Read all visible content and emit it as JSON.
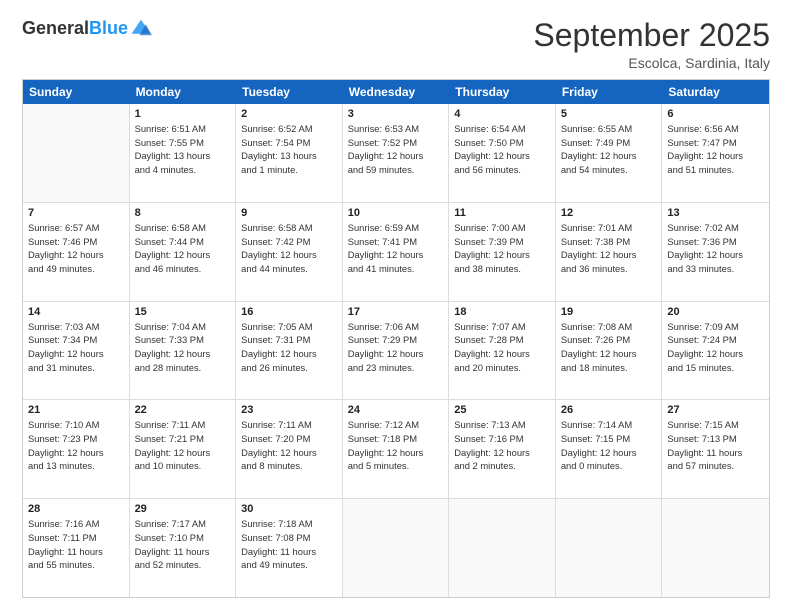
{
  "logo": {
    "general": "General",
    "blue": "Blue"
  },
  "title": "September 2025",
  "subtitle": "Escolca, Sardinia, Italy",
  "days": [
    "Sunday",
    "Monday",
    "Tuesday",
    "Wednesday",
    "Thursday",
    "Friday",
    "Saturday"
  ],
  "weeks": [
    [
      {
        "day": "",
        "lines": []
      },
      {
        "day": "1",
        "lines": [
          "Sunrise: 6:51 AM",
          "Sunset: 7:55 PM",
          "Daylight: 13 hours",
          "and 4 minutes."
        ]
      },
      {
        "day": "2",
        "lines": [
          "Sunrise: 6:52 AM",
          "Sunset: 7:54 PM",
          "Daylight: 13 hours",
          "and 1 minute."
        ]
      },
      {
        "day": "3",
        "lines": [
          "Sunrise: 6:53 AM",
          "Sunset: 7:52 PM",
          "Daylight: 12 hours",
          "and 59 minutes."
        ]
      },
      {
        "day": "4",
        "lines": [
          "Sunrise: 6:54 AM",
          "Sunset: 7:50 PM",
          "Daylight: 12 hours",
          "and 56 minutes."
        ]
      },
      {
        "day": "5",
        "lines": [
          "Sunrise: 6:55 AM",
          "Sunset: 7:49 PM",
          "Daylight: 12 hours",
          "and 54 minutes."
        ]
      },
      {
        "day": "6",
        "lines": [
          "Sunrise: 6:56 AM",
          "Sunset: 7:47 PM",
          "Daylight: 12 hours",
          "and 51 minutes."
        ]
      }
    ],
    [
      {
        "day": "7",
        "lines": [
          "Sunrise: 6:57 AM",
          "Sunset: 7:46 PM",
          "Daylight: 12 hours",
          "and 49 minutes."
        ]
      },
      {
        "day": "8",
        "lines": [
          "Sunrise: 6:58 AM",
          "Sunset: 7:44 PM",
          "Daylight: 12 hours",
          "and 46 minutes."
        ]
      },
      {
        "day": "9",
        "lines": [
          "Sunrise: 6:58 AM",
          "Sunset: 7:42 PM",
          "Daylight: 12 hours",
          "and 44 minutes."
        ]
      },
      {
        "day": "10",
        "lines": [
          "Sunrise: 6:59 AM",
          "Sunset: 7:41 PM",
          "Daylight: 12 hours",
          "and 41 minutes."
        ]
      },
      {
        "day": "11",
        "lines": [
          "Sunrise: 7:00 AM",
          "Sunset: 7:39 PM",
          "Daylight: 12 hours",
          "and 38 minutes."
        ]
      },
      {
        "day": "12",
        "lines": [
          "Sunrise: 7:01 AM",
          "Sunset: 7:38 PM",
          "Daylight: 12 hours",
          "and 36 minutes."
        ]
      },
      {
        "day": "13",
        "lines": [
          "Sunrise: 7:02 AM",
          "Sunset: 7:36 PM",
          "Daylight: 12 hours",
          "and 33 minutes."
        ]
      }
    ],
    [
      {
        "day": "14",
        "lines": [
          "Sunrise: 7:03 AM",
          "Sunset: 7:34 PM",
          "Daylight: 12 hours",
          "and 31 minutes."
        ]
      },
      {
        "day": "15",
        "lines": [
          "Sunrise: 7:04 AM",
          "Sunset: 7:33 PM",
          "Daylight: 12 hours",
          "and 28 minutes."
        ]
      },
      {
        "day": "16",
        "lines": [
          "Sunrise: 7:05 AM",
          "Sunset: 7:31 PM",
          "Daylight: 12 hours",
          "and 26 minutes."
        ]
      },
      {
        "day": "17",
        "lines": [
          "Sunrise: 7:06 AM",
          "Sunset: 7:29 PM",
          "Daylight: 12 hours",
          "and 23 minutes."
        ]
      },
      {
        "day": "18",
        "lines": [
          "Sunrise: 7:07 AM",
          "Sunset: 7:28 PM",
          "Daylight: 12 hours",
          "and 20 minutes."
        ]
      },
      {
        "day": "19",
        "lines": [
          "Sunrise: 7:08 AM",
          "Sunset: 7:26 PM",
          "Daylight: 12 hours",
          "and 18 minutes."
        ]
      },
      {
        "day": "20",
        "lines": [
          "Sunrise: 7:09 AM",
          "Sunset: 7:24 PM",
          "Daylight: 12 hours",
          "and 15 minutes."
        ]
      }
    ],
    [
      {
        "day": "21",
        "lines": [
          "Sunrise: 7:10 AM",
          "Sunset: 7:23 PM",
          "Daylight: 12 hours",
          "and 13 minutes."
        ]
      },
      {
        "day": "22",
        "lines": [
          "Sunrise: 7:11 AM",
          "Sunset: 7:21 PM",
          "Daylight: 12 hours",
          "and 10 minutes."
        ]
      },
      {
        "day": "23",
        "lines": [
          "Sunrise: 7:11 AM",
          "Sunset: 7:20 PM",
          "Daylight: 12 hours",
          "and 8 minutes."
        ]
      },
      {
        "day": "24",
        "lines": [
          "Sunrise: 7:12 AM",
          "Sunset: 7:18 PM",
          "Daylight: 12 hours",
          "and 5 minutes."
        ]
      },
      {
        "day": "25",
        "lines": [
          "Sunrise: 7:13 AM",
          "Sunset: 7:16 PM",
          "Daylight: 12 hours",
          "and 2 minutes."
        ]
      },
      {
        "day": "26",
        "lines": [
          "Sunrise: 7:14 AM",
          "Sunset: 7:15 PM",
          "Daylight: 12 hours",
          "and 0 minutes."
        ]
      },
      {
        "day": "27",
        "lines": [
          "Sunrise: 7:15 AM",
          "Sunset: 7:13 PM",
          "Daylight: 11 hours",
          "and 57 minutes."
        ]
      }
    ],
    [
      {
        "day": "28",
        "lines": [
          "Sunrise: 7:16 AM",
          "Sunset: 7:11 PM",
          "Daylight: 11 hours",
          "and 55 minutes."
        ]
      },
      {
        "day": "29",
        "lines": [
          "Sunrise: 7:17 AM",
          "Sunset: 7:10 PM",
          "Daylight: 11 hours",
          "and 52 minutes."
        ]
      },
      {
        "day": "30",
        "lines": [
          "Sunrise: 7:18 AM",
          "Sunset: 7:08 PM",
          "Daylight: 11 hours",
          "and 49 minutes."
        ]
      },
      {
        "day": "",
        "lines": []
      },
      {
        "day": "",
        "lines": []
      },
      {
        "day": "",
        "lines": []
      },
      {
        "day": "",
        "lines": []
      }
    ]
  ]
}
